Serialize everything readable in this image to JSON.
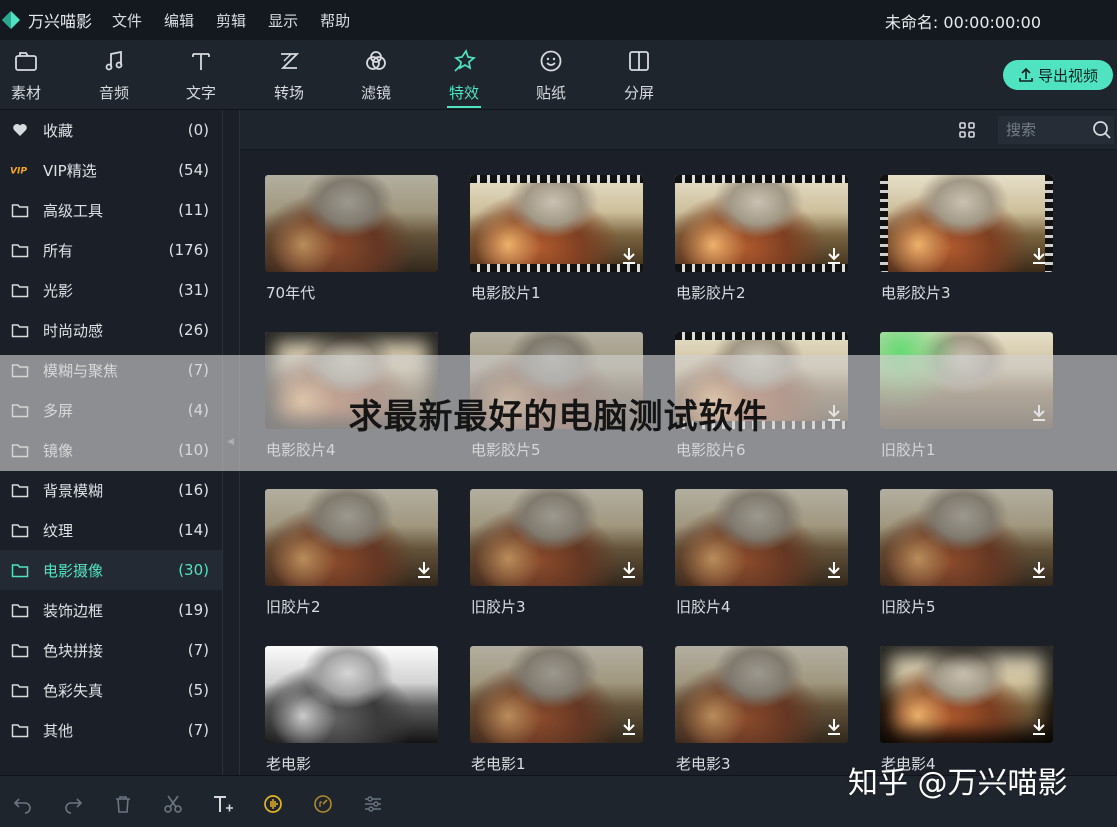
{
  "app": {
    "name": "万兴喵影",
    "project_title": "未命名: 00:00:00:00",
    "menu": [
      "文件",
      "编辑",
      "剪辑",
      "显示",
      "帮助"
    ]
  },
  "toolbar": {
    "tools": [
      {
        "label": "素材",
        "icon": "media-folder-icon"
      },
      {
        "label": "音频",
        "icon": "music-note-icon"
      },
      {
        "label": "文字",
        "icon": "text-icon"
      },
      {
        "label": "转场",
        "icon": "transition-icon"
      },
      {
        "label": "滤镜",
        "icon": "filter-icon"
      },
      {
        "label": "特效",
        "icon": "effects-icon",
        "active": true
      },
      {
        "label": "贴纸",
        "icon": "sticker-icon"
      },
      {
        "label": "分屏",
        "icon": "split-screen-icon"
      }
    ],
    "export_label": "导出视频"
  },
  "sidebar": {
    "items": [
      {
        "name": "收藏",
        "count": "(0)",
        "icon": "heart-icon"
      },
      {
        "name": "VIP精选",
        "count": "(54)",
        "icon": "vip-icon"
      },
      {
        "name": "高级工具",
        "count": "(11)",
        "icon": "folder-icon"
      },
      {
        "name": "所有",
        "count": "(176)",
        "icon": "folder-icon"
      },
      {
        "name": "光影",
        "count": "(31)",
        "icon": "folder-icon"
      },
      {
        "name": "时尚动感",
        "count": "(26)",
        "icon": "folder-icon"
      },
      {
        "name": "模糊与聚焦",
        "count": "(7)",
        "icon": "folder-icon"
      },
      {
        "name": "多屏",
        "count": "(4)",
        "icon": "folder-icon"
      },
      {
        "name": "镜像",
        "count": "(10)",
        "icon": "folder-icon"
      },
      {
        "name": "背景模糊",
        "count": "(16)",
        "icon": "folder-icon"
      },
      {
        "name": "纹理",
        "count": "(14)",
        "icon": "folder-icon"
      },
      {
        "name": "电影摄像",
        "count": "(30)",
        "icon": "folder-icon",
        "active": true
      },
      {
        "name": "装饰边框",
        "count": "(19)",
        "icon": "folder-icon"
      },
      {
        "name": "色块拼接",
        "count": "(7)",
        "icon": "folder-icon"
      },
      {
        "name": "色彩失真",
        "count": "(5)",
        "icon": "folder-icon"
      },
      {
        "name": "其他",
        "count": "(7)",
        "icon": "folder-icon"
      }
    ]
  },
  "search": {
    "placeholder": "搜索"
  },
  "effects": [
    {
      "label": "70年代",
      "download": false
    },
    {
      "label": "电影胶片1",
      "download": true
    },
    {
      "label": "电影胶片2",
      "download": true
    },
    {
      "label": "电影胶片3",
      "download": true
    },
    {
      "label": "电影胶片4",
      "download": false
    },
    {
      "label": "电影胶片5",
      "download": false
    },
    {
      "label": "电影胶片6",
      "download": true
    },
    {
      "label": "旧胶片1",
      "download": true
    },
    {
      "label": "旧胶片2",
      "download": true
    },
    {
      "label": "旧胶片3",
      "download": true
    },
    {
      "label": "旧胶片4",
      "download": true
    },
    {
      "label": "旧胶片5",
      "download": true
    },
    {
      "label": "老电影",
      "download": false
    },
    {
      "label": "老电影1",
      "download": true
    },
    {
      "label": "老电影3",
      "download": true
    },
    {
      "label": "老电影4",
      "download": true
    }
  ],
  "banner": {
    "text": "求最新最好的电脑测试软件"
  },
  "watermark": {
    "text": "知乎 @万兴喵影"
  },
  "bottom_tools": [
    "undo-icon",
    "redo-icon",
    "delete-icon",
    "cut-icon",
    "add-text-icon",
    "audio-sync-icon",
    "speed-icon",
    "adjust-icon"
  ],
  "colors": {
    "accent": "#4fe3c1",
    "export_button": "#50e3c2",
    "background": "#1b2028"
  }
}
